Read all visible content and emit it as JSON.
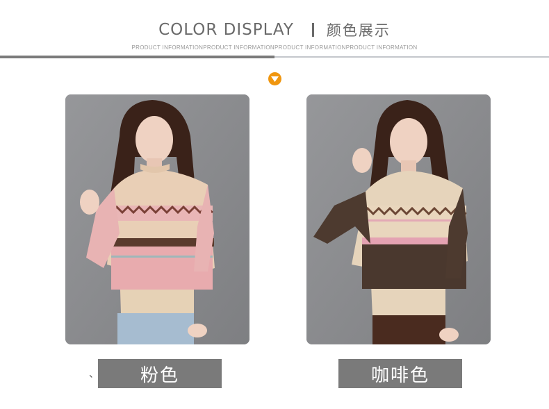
{
  "header": {
    "title_en": "COLOR DISPLAY",
    "title_cn": "颜色展示",
    "subtitle": "PRODUCT INFORMATIONPRODUCT INFORMATIONPRODUCT INFORMATIONPRODUCT INFORMATION"
  },
  "marker": {
    "icon": "chevron-down-icon",
    "color": "#f0960f"
  },
  "stray_mark": "、",
  "colors": [
    {
      "label": "粉色",
      "swatch": "#e8aeb0"
    },
    {
      "label": "咖啡色",
      "swatch": "#4a382e"
    }
  ]
}
